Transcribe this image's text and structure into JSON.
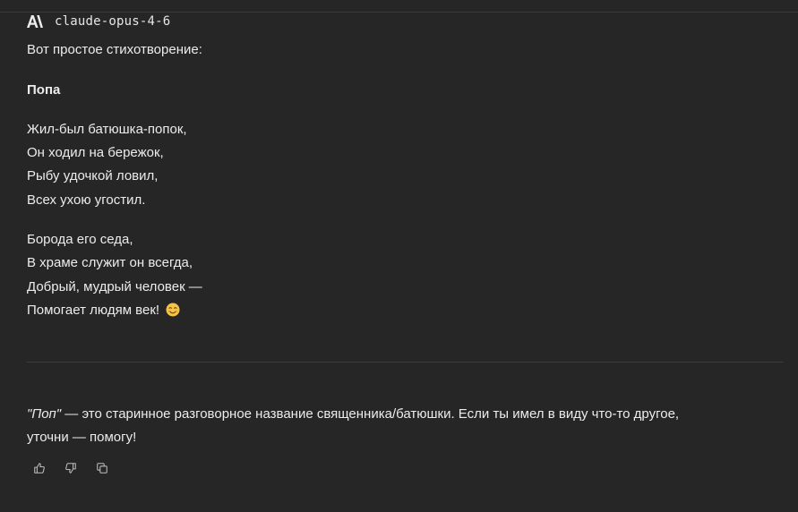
{
  "header": {
    "model_name": "claude-opus-4-6",
    "logo_icon": "anthropic-logo-icon"
  },
  "message": {
    "intro": "Вот простое стихотворение:",
    "poem_title": "Попа",
    "stanza1": [
      "Жил-был батюшка-попок,",
      "Он ходил на бережок,",
      "Рыбу удочкой ловил,",
      "Всех ухою угостил."
    ],
    "stanza2": [
      "Борода его седа,",
      "В храме служит он всегда,",
      "Добрый, мудрый человек —",
      "Помогает людям век!"
    ],
    "emoji": "smiling-face-emoji",
    "note_term": "\"Поп\"",
    "note_line1_rest": " — это старинное разговорное название священника/батюшки. Если ты имел в виду что-то другое,",
    "note_line2": "уточни — помогу!"
  },
  "actions": {
    "icons": [
      "thumbs-up-icon",
      "thumbs-down-icon",
      "copy-icon"
    ]
  },
  "colors": {
    "background": "#262626",
    "text": "#ececec",
    "divider": "#3d3d3d",
    "icon": "#bdbdbd"
  }
}
